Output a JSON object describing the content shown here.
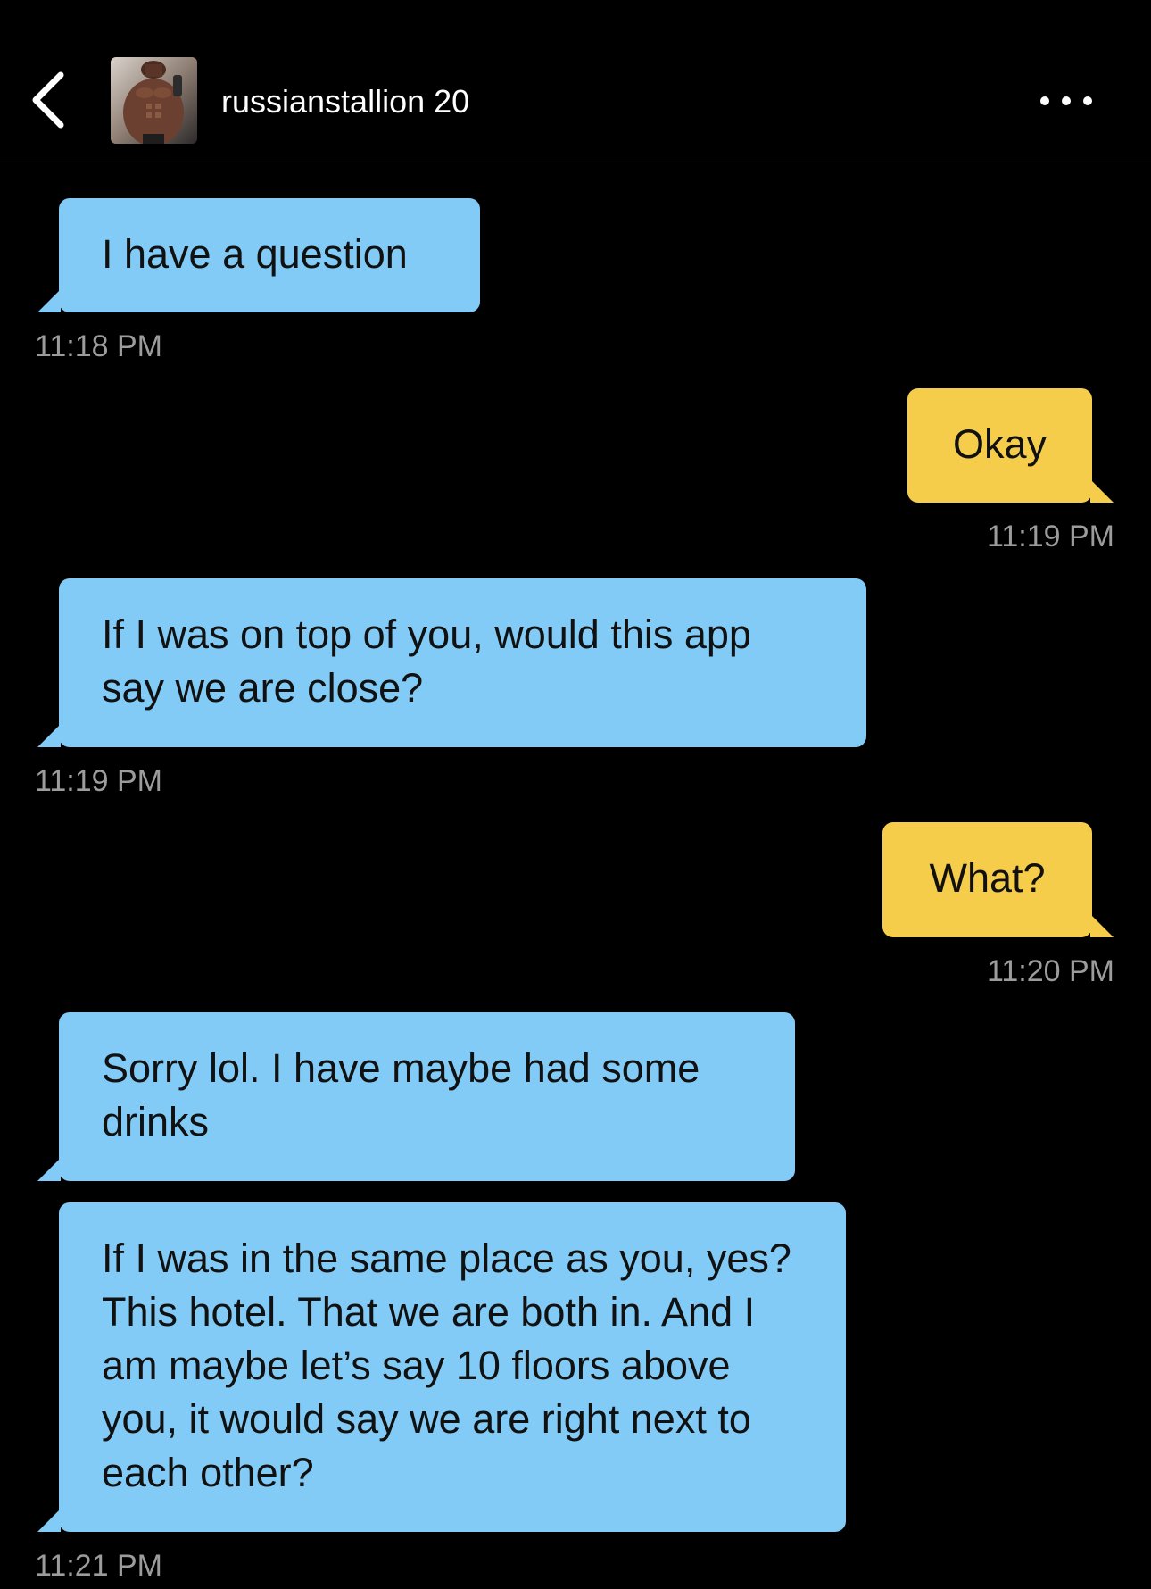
{
  "header": {
    "back_icon": "chevron-left-icon",
    "avatar_alt": "profile photo",
    "username": "russianstallion 20",
    "more_icon": "more-horizontal-icon"
  },
  "colors": {
    "background": "#000000",
    "incoming_bubble": "#81cbf6",
    "outgoing_bubble": "#f6cd4b",
    "timestamp": "#9c9c9c"
  },
  "messages": [
    {
      "direction": "in",
      "text": "I have a question",
      "time": "11:18 PM"
    },
    {
      "direction": "out",
      "text": "Okay",
      "time": "11:19 PM"
    },
    {
      "direction": "in",
      "text": "If I was on top of you, would this app say we are close?",
      "time": "11:19 PM"
    },
    {
      "direction": "out",
      "text": "What?",
      "time": "11:20 PM"
    },
    {
      "direction": "in",
      "text": "Sorry lol. I have maybe had some drinks",
      "time": ""
    },
    {
      "direction": "in",
      "text": "If I was in the same place as you, yes? This hotel. That we are both in. And I am maybe let’s say 10 floors above you, it would say we are right next to each other?",
      "time": "11:21 PM"
    }
  ]
}
